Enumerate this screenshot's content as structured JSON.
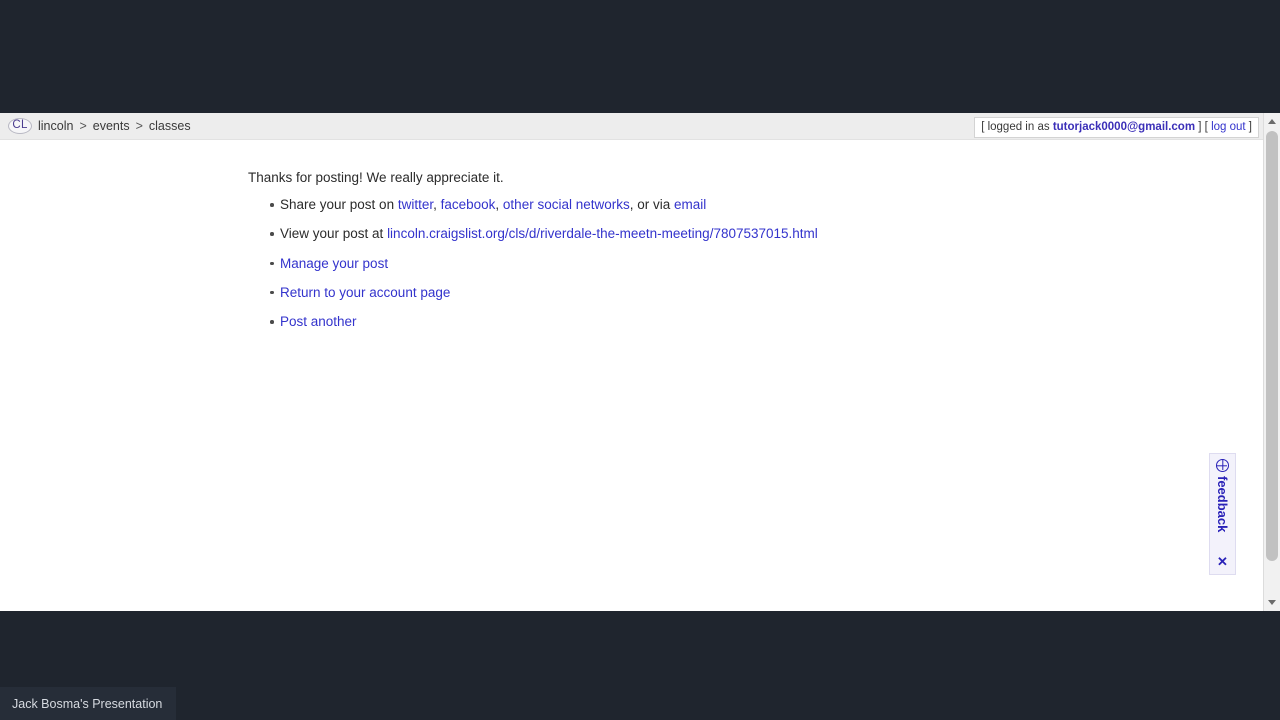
{
  "browser": {
    "header": {
      "logo_text": "CL",
      "breadcrumb": [
        {
          "label": "lincoln"
        },
        {
          "label": "events"
        },
        {
          "label": "classes"
        }
      ],
      "separator": ">",
      "login": {
        "prefix": "[ logged in as",
        "email": "tutorjack0000@gmail.com",
        "middle": "] [",
        "logout_label": "log out",
        "suffix": "]"
      }
    },
    "main": {
      "thanks_message": "Thanks for posting! We really appreciate it.",
      "actions": [
        {
          "id": "share",
          "prefix": "Share your post on ",
          "links": [
            {
              "label": "twitter",
              "after": ", "
            },
            {
              "label": "facebook",
              "after": ", "
            },
            {
              "label": "other social networks",
              "after": ", or via "
            },
            {
              "label": "email",
              "after": ""
            }
          ]
        },
        {
          "id": "view",
          "prefix": "View your post at ",
          "url": "lincoln.craigslist.org/cls/d/riverdale-the-meetn-meeting/7807537015.html"
        },
        {
          "id": "manage",
          "link_label": "Manage your post"
        },
        {
          "id": "account",
          "link_label": "Return to your account page"
        },
        {
          "id": "post-another",
          "link_label": "Post another"
        }
      ]
    },
    "feedback": {
      "label": "feedback",
      "close_label": "✕",
      "icon": "globe-icon"
    },
    "scrollbar": {
      "up_arrow": "scroll-up-arrow",
      "down_arrow": "scroll-down-arrow"
    }
  },
  "desktop": {
    "taskbar_item_label": "Jack Bosma's Presentation"
  },
  "colors": {
    "link": "#3333cc",
    "header_bg": "#ededed",
    "desktop_bg": "#1f252e",
    "feedback_accent": "#2a22b8"
  }
}
